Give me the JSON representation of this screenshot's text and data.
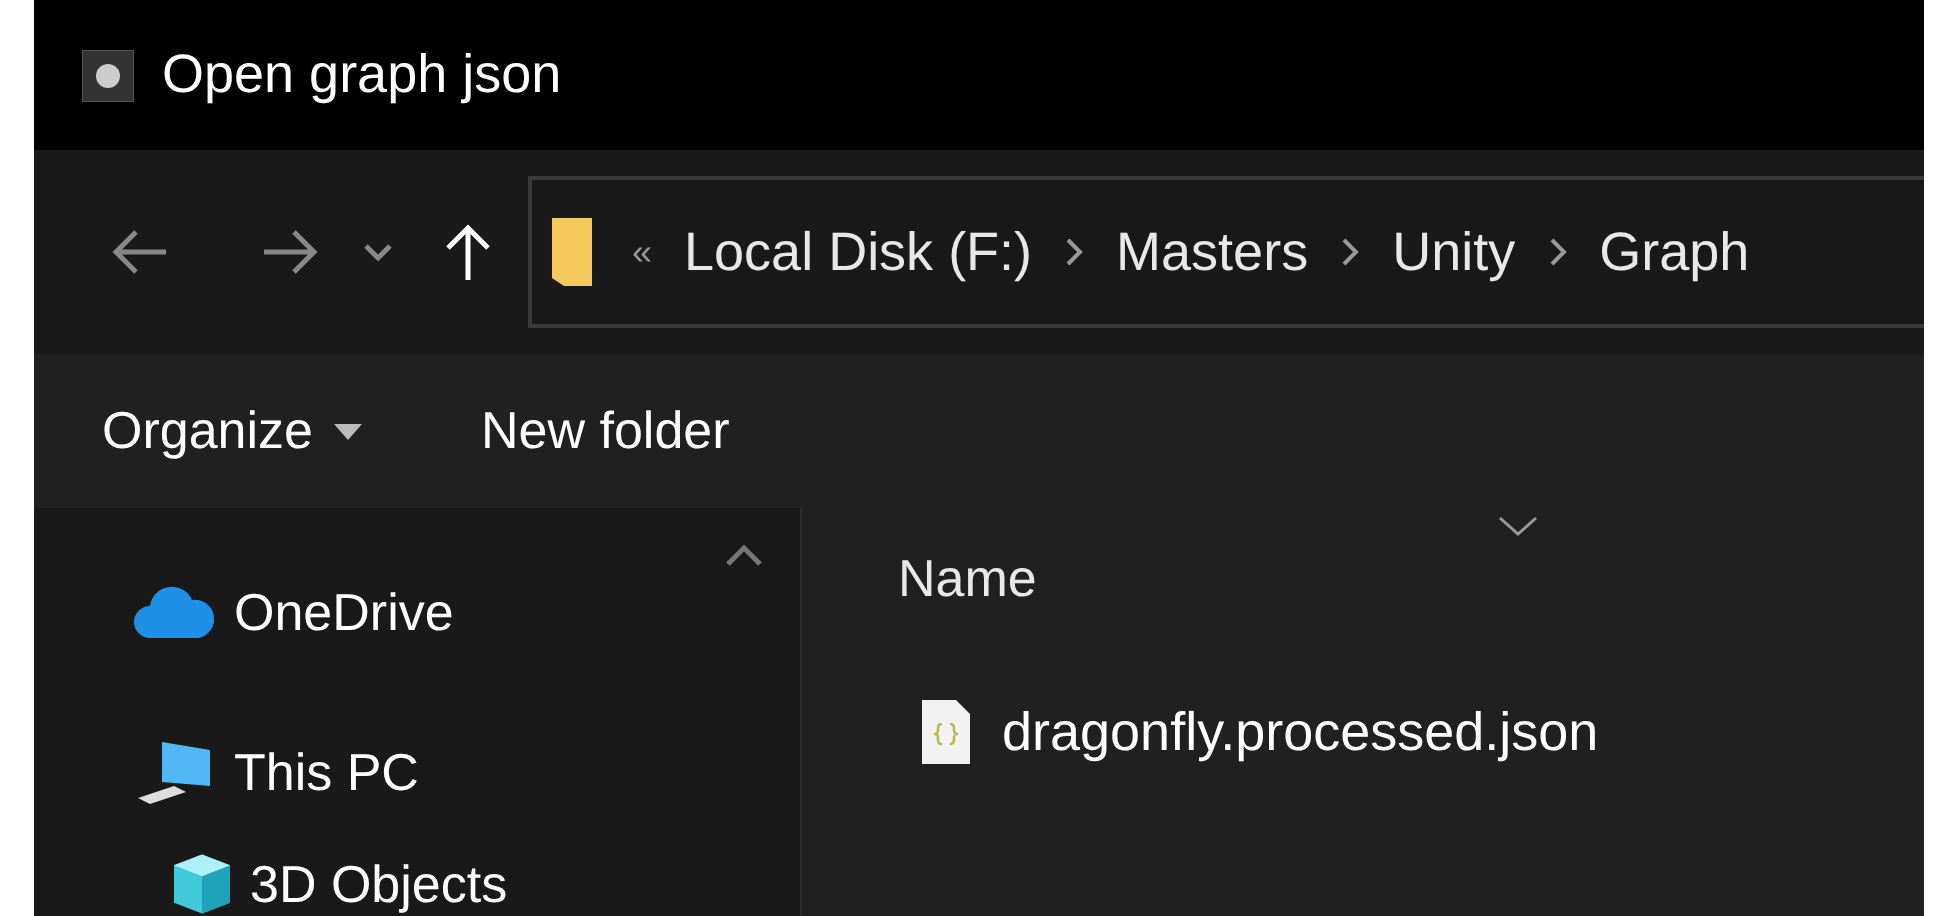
{
  "window": {
    "title": "Open graph json"
  },
  "address_bar": {
    "overflow": "«",
    "path": [
      "Local Disk (F:)",
      "Masters",
      "Unity",
      "Graph"
    ]
  },
  "command_bar": {
    "organize": "Organize",
    "new_folder": "New folder"
  },
  "sidebar": {
    "items": [
      {
        "label": "OneDrive",
        "kind": "cloud"
      },
      {
        "label": "This PC",
        "kind": "computer",
        "children": [
          {
            "label": "3D Objects",
            "kind": "cube"
          }
        ]
      }
    ]
  },
  "file_list": {
    "columns": [
      "Name"
    ],
    "files": [
      {
        "name": "dragonfly.processed.json",
        "kind": "json"
      }
    ]
  }
}
